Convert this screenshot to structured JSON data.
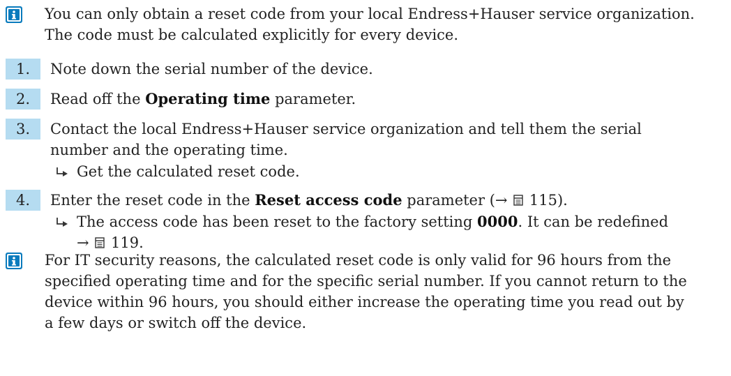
{
  "note_intro": {
    "line1": "You can only obtain a reset code from your local Endress+Hauser service organization.",
    "line2": "The code must be calculated explicitly for every device."
  },
  "steps": [
    {
      "number": "1.",
      "text": "Note down the serial number of the device."
    },
    {
      "number": "2.",
      "text_before": "Read off the ",
      "bold": "Operating time",
      "text_after": " parameter."
    },
    {
      "number": "3.",
      "line1": "Contact the local Endress+Hauser service organization and tell them the serial",
      "line2": "number and the operating time.",
      "result": "Get the calculated reset code."
    },
    {
      "number": "4.",
      "text_before": "Enter the reset code in the ",
      "bold": "Reset access code",
      "text_after": " parameter (→ ",
      "page_ref": "115",
      "text_end": ").",
      "result_before": "The access code has been reset to the factory setting ",
      "result_bold": "0000",
      "result_after": ". It can be redefined",
      "result_line2_arrow": "→ ",
      "result_page_ref": "119",
      "result_line2_end": "."
    }
  ],
  "note_security": {
    "line1": "For IT security reasons, the calculated reset code is only valid for 96 hours from the",
    "line2": "specified operating time and for the specific serial number. If you cannot return to the",
    "line3": "device within 96 hours, you should either increase the operating time you read out by",
    "line4": "a few days or switch off the device."
  },
  "colors": {
    "step_badge": "#b5dcf1",
    "info_icon": "#0a7bbd"
  },
  "icons": {
    "info": "info-icon",
    "result": "result-arrow-icon",
    "page_reference": "manual-page-icon"
  }
}
